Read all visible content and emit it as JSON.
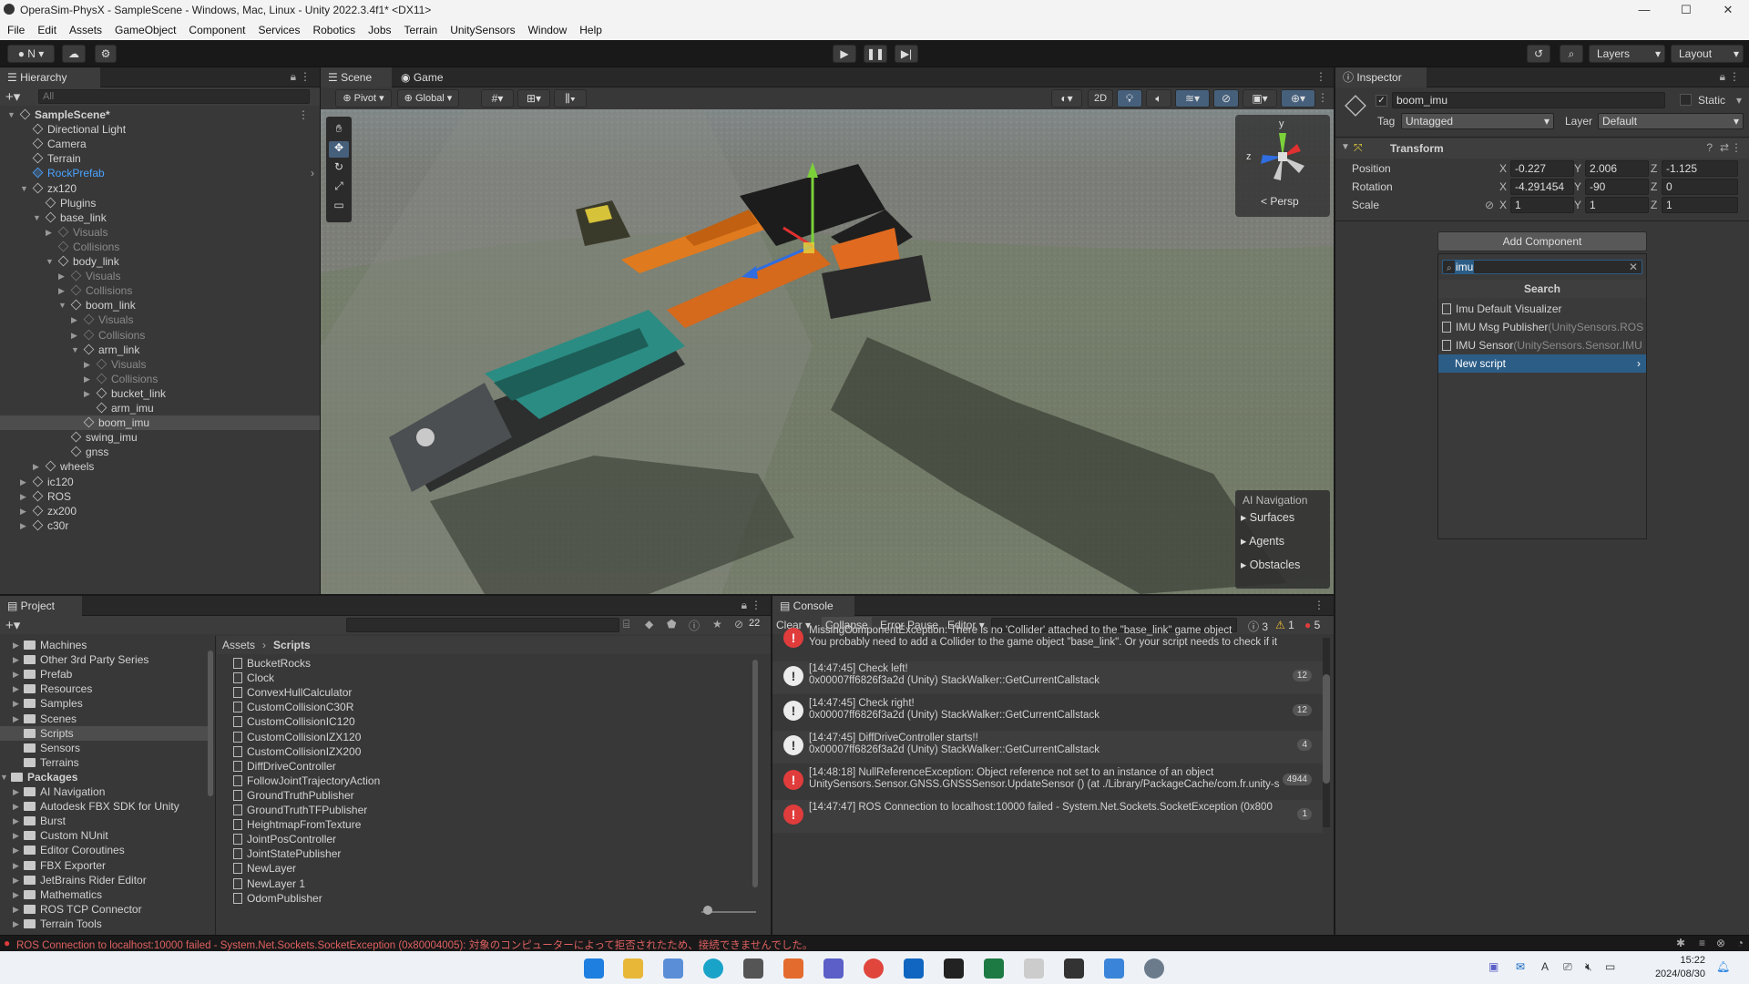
{
  "window": {
    "title": "OperaSim-PhysX - SampleScene - Windows, Mac, Linux - Unity 2022.3.4f1* <DX11>",
    "min": "—",
    "max": "☐",
    "close": "✕"
  },
  "menu": [
    "File",
    "Edit",
    "Assets",
    "GameObject",
    "Component",
    "Services",
    "Robotics",
    "Jobs",
    "Terrain",
    "UnitySensors",
    "Window",
    "Help"
  ],
  "toolbar": {
    "account": "N",
    "layers": "Layers",
    "layout": "Layout"
  },
  "hierarchy": {
    "tab": "Hierarchy",
    "search_placeholder": "All",
    "items": [
      {
        "label": "SampleScene*",
        "depth": 0,
        "arrow": "▼",
        "style": "scene"
      },
      {
        "label": "Directional Light",
        "depth": 1,
        "arrow": "",
        "style": "normal"
      },
      {
        "label": "Camera",
        "depth": 1,
        "arrow": "",
        "style": "normal"
      },
      {
        "label": "Terrain",
        "depth": 1,
        "arrow": "",
        "style": "normal"
      },
      {
        "label": "RockPrefab",
        "depth": 1,
        "arrow": "",
        "style": "blue"
      },
      {
        "label": "zx120",
        "depth": 1,
        "arrow": "▼",
        "style": "normal"
      },
      {
        "label": "Plugins",
        "depth": 2,
        "arrow": "",
        "style": "normal"
      },
      {
        "label": "base_link",
        "depth": 2,
        "arrow": "▼",
        "style": "normal"
      },
      {
        "label": "Visuals",
        "depth": 3,
        "arrow": "▶",
        "style": "dim"
      },
      {
        "label": "Collisions",
        "depth": 3,
        "arrow": "",
        "style": "dim"
      },
      {
        "label": "body_link",
        "depth": 3,
        "arrow": "▼",
        "style": "normal"
      },
      {
        "label": "Visuals",
        "depth": 4,
        "arrow": "▶",
        "style": "dim"
      },
      {
        "label": "Collisions",
        "depth": 4,
        "arrow": "▶",
        "style": "dim"
      },
      {
        "label": "boom_link",
        "depth": 4,
        "arrow": "▼",
        "style": "normal"
      },
      {
        "label": "Visuals",
        "depth": 5,
        "arrow": "▶",
        "style": "dim"
      },
      {
        "label": "Collisions",
        "depth": 5,
        "arrow": "▶",
        "style": "dim"
      },
      {
        "label": "arm_link",
        "depth": 5,
        "arrow": "▼",
        "style": "normal"
      },
      {
        "label": "Visuals",
        "depth": 6,
        "arrow": "▶",
        "style": "dim"
      },
      {
        "label": "Collisions",
        "depth": 6,
        "arrow": "▶",
        "style": "dim"
      },
      {
        "label": "bucket_link",
        "depth": 6,
        "arrow": "▶",
        "style": "normal"
      },
      {
        "label": "arm_imu",
        "depth": 6,
        "arrow": "",
        "style": "normal"
      },
      {
        "label": "boom_imu",
        "depth": 5,
        "arrow": "",
        "style": "selected"
      },
      {
        "label": "swing_imu",
        "depth": 4,
        "arrow": "",
        "style": "normal"
      },
      {
        "label": "gnss",
        "depth": 4,
        "arrow": "",
        "style": "normal"
      },
      {
        "label": "wheels",
        "depth": 2,
        "arrow": "▶",
        "style": "normal"
      },
      {
        "label": "ic120",
        "depth": 1,
        "arrow": "▶",
        "style": "normal"
      },
      {
        "label": "ROS",
        "depth": 1,
        "arrow": "▶",
        "style": "normal"
      },
      {
        "label": "zx200",
        "depth": 1,
        "arrow": "▶",
        "style": "normal"
      },
      {
        "label": "c30r",
        "depth": 1,
        "arrow": "▶",
        "style": "normal"
      }
    ]
  },
  "scene": {
    "tabs": [
      "Scene",
      "Game"
    ],
    "pivot": "Pivot",
    "global": "Global",
    "mode2d": "2D",
    "persp": "< Persp",
    "gizmo_y": "y",
    "gizmo_z": "z",
    "ai_nav": {
      "title": "AI Navigation",
      "items": [
        "Surfaces",
        "Agents",
        "Obstacles"
      ]
    }
  },
  "inspector": {
    "tab": "Inspector",
    "object_name": "boom_imu",
    "static": "Static",
    "tag_label": "Tag",
    "tag_value": "Untagged",
    "layer_label": "Layer",
    "layer_value": "Default",
    "transform_title": "Transform",
    "rows": [
      {
        "label": "Position",
        "x": "-0.227",
        "y": "2.006",
        "z": "-1.125"
      },
      {
        "label": "Rotation",
        "x": "-4.291454",
        "y": "-90",
        "z": "0"
      },
      {
        "label": "Scale",
        "x": "1",
        "y": "1",
        "z": "1"
      }
    ],
    "add_component": "Add Component",
    "search_value": "imu",
    "search_header": "Search",
    "results": [
      {
        "name": "Imu Default Visualizer",
        "ns": ""
      },
      {
        "name": "IMU Msg Publisher",
        "ns": "(UnitySensors.ROS"
      },
      {
        "name": "IMU Sensor",
        "ns": "(UnitySensors.Sensor.IMU"
      }
    ],
    "new_script": "New script"
  },
  "project": {
    "tab": "Project",
    "count": "22",
    "folders": [
      {
        "label": "Machines",
        "depth": 1
      },
      {
        "label": "Other 3rd Party Series",
        "depth": 1
      },
      {
        "label": "Prefab",
        "depth": 1
      },
      {
        "label": "Resources",
        "depth": 1
      },
      {
        "label": "Samples",
        "depth": 1
      },
      {
        "label": "Scenes",
        "depth": 1
      },
      {
        "label": "Scripts",
        "depth": 1,
        "selected": true
      },
      {
        "label": "Sensors",
        "depth": 1
      },
      {
        "label": "Terrains",
        "depth": 1
      },
      {
        "label": "Packages",
        "depth": 0,
        "bold": true
      },
      {
        "label": "AI Navigation",
        "depth": 1
      },
      {
        "label": "Autodesk FBX SDK for Unity",
        "depth": 1
      },
      {
        "label": "Burst",
        "depth": 1
      },
      {
        "label": "Custom NUnit",
        "depth": 1
      },
      {
        "label": "Editor Coroutines",
        "depth": 1
      },
      {
        "label": "FBX Exporter",
        "depth": 1
      },
      {
        "label": "JetBrains Rider Editor",
        "depth": 1
      },
      {
        "label": "Mathematics",
        "depth": 1
      },
      {
        "label": "ROS TCP Connector",
        "depth": 1
      },
      {
        "label": "Terrain Tools",
        "depth": 1
      }
    ],
    "breadcrumb": [
      "Assets",
      "Scripts"
    ],
    "files": [
      "BucketRocks",
      "Clock",
      "ConvexHullCalculator",
      "CustomCollisionC30R",
      "CustomCollisionIC120",
      "CustomCollisionIZX120",
      "CustomCollisionIZX200",
      "DiffDriveController",
      "FollowJointTrajectoryAction",
      "GroundTruthPublisher",
      "GroundTruthTFPublisher",
      "HeightmapFromTexture",
      "JointPosController",
      "JointStatePublisher",
      "NewLayer",
      "NewLayer 1",
      "OdomPublisher"
    ]
  },
  "console": {
    "tab": "Console",
    "clear": "Clear",
    "collapse": "Collapse",
    "error_pause": "Error Pause",
    "editor": "Editor",
    "info_count": "3",
    "warn_count": "1",
    "err_count": "5",
    "entries": [
      {
        "type": "error",
        "l1": "MissingComponentException: There is no 'Collider' attached to the \"base_link\" game object",
        "l2": "You probably need to add a Collider to the game object \"base_link\". Or your script needs to check if it",
        "count": ""
      },
      {
        "type": "info",
        "l1": "[14:47:45] Check left!",
        "l2": "0x00007ff6826f3a2d (Unity) StackWalker::GetCurrentCallstack",
        "count": "12"
      },
      {
        "type": "info",
        "l1": "[14:47:45] Check right!",
        "l2": "0x00007ff6826f3a2d (Unity) StackWalker::GetCurrentCallstack",
        "count": "12"
      },
      {
        "type": "info",
        "l1": "[14:47:45] DiffDriveController starts!!",
        "l2": "0x00007ff6826f3a2d (Unity) StackWalker::GetCurrentCallstack",
        "count": "4"
      },
      {
        "type": "error",
        "l1": "[14:48:18] NullReferenceException: Object reference not set to an instance of an object",
        "l2": "UnitySensors.Sensor.GNSS.GNSSSensor.UpdateSensor () (at ./Library/PackageCache/com.fr.unity-s",
        "count": "4944"
      },
      {
        "type": "error",
        "l1": "[14:47:47] ROS Connection to localhost:10000 failed - System.Net.Sockets.SocketException (0x800",
        "l2": "",
        "count": "1"
      }
    ]
  },
  "status": {
    "message": "ROS Connection to localhost:10000 failed - System.Net.Sockets.SocketException (0x80004005): 対象のコンピューターによって拒否されたため、接続できませんでした。"
  },
  "taskbar": {
    "time": "15:22",
    "date": "2024/08/30"
  },
  "colors": {
    "accent": "#2c5d87",
    "selected": "#2c5d87",
    "error": "#e03c3c",
    "warning": "#f0c030"
  }
}
